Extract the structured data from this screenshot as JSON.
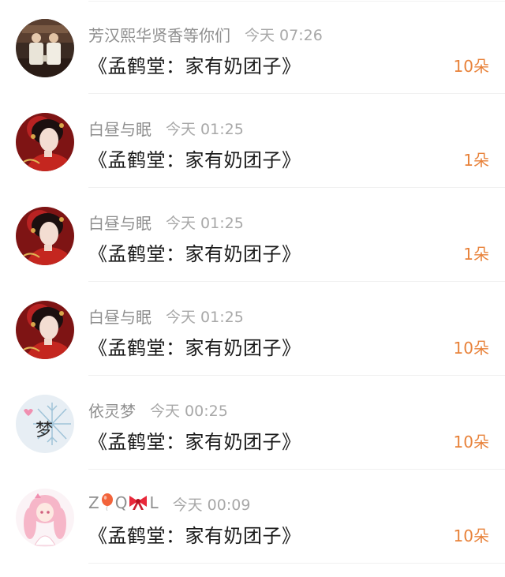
{
  "items": [
    {
      "avatar": "photo-two-men-on-stage-avatar",
      "name": "芳汉熙华贤香等你们",
      "time": "今天 07:26",
      "title": "《孟鹤堂：家有奶团子》",
      "count": "10朵"
    },
    {
      "avatar": "illustrated-woman-red-dress-avatar",
      "name": "白昼与眠",
      "time": "今天 01:25",
      "title": "《孟鹤堂：家有奶团子》",
      "count": "1朵"
    },
    {
      "avatar": "illustrated-woman-red-dress-avatar",
      "name": "白昼与眠",
      "time": "今天 01:25",
      "title": "《孟鹤堂：家有奶团子》",
      "count": "1朵"
    },
    {
      "avatar": "illustrated-woman-red-dress-avatar",
      "name": "白昼与眠",
      "time": "今天 01:25",
      "title": "《孟鹤堂：家有奶团子》",
      "count": "10朵"
    },
    {
      "avatar": "snowflake-meng-character-avatar",
      "name": "依灵梦",
      "avatar_text": "梦",
      "time": "今天 00:25",
      "title": "《孟鹤堂：家有奶团子》",
      "count": "10朵"
    },
    {
      "avatar": "pink-anime-girl-avatar",
      "name_parts": [
        "Z",
        "Q",
        "L"
      ],
      "name_emojis": [
        "balloon-icon",
        "ribbon-bow-icon"
      ],
      "time": "今天 00:09",
      "title": "《孟鹤堂：家有奶团子》",
      "count": "10朵"
    }
  ],
  "colors": {
    "name": "#8f8f8f",
    "time": "#a8a8a8",
    "title": "#1a1a1a",
    "count": "#e8823a",
    "divider": "#f0f0f0"
  }
}
